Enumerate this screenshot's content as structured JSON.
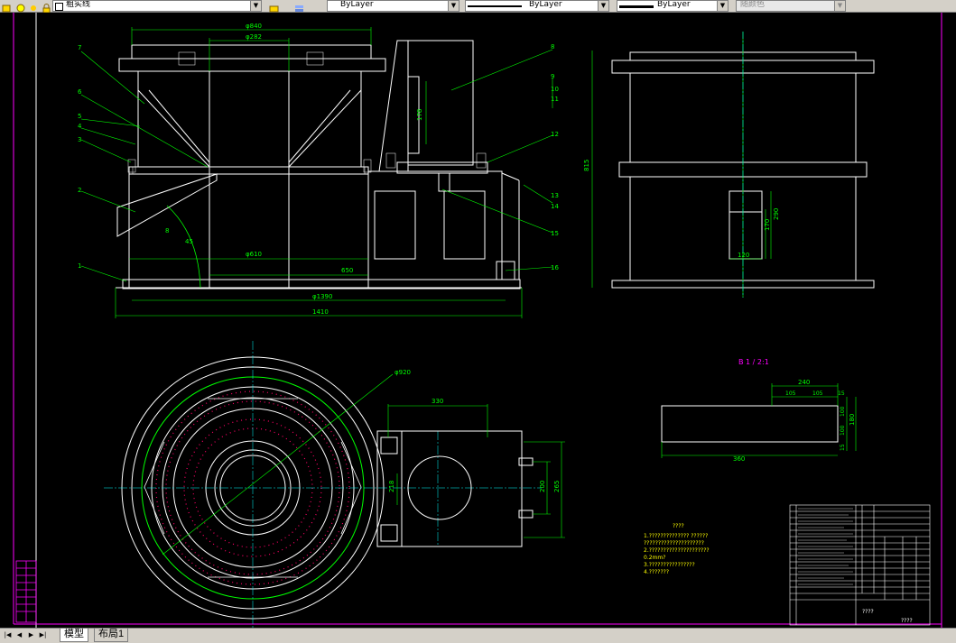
{
  "toolbar": {
    "layer_name": "粗实线",
    "color_value": "ByLayer",
    "linetype_value": "ByLayer",
    "lineweight_value": "ByLayer",
    "plotstyle_value": "随颜色"
  },
  "tabs": {
    "model": "模型",
    "layout1": "布局1"
  },
  "drawing": {
    "dims": {
      "d840": "φ840",
      "d282": "φ282",
      "d610": "φ610",
      "d1390": "φ1390",
      "w1410": "1410",
      "w650": "650",
      "h178": "178",
      "h815": "815",
      "d920": "φ920",
      "w330": "330",
      "h200": "200",
      "h265": "265",
      "h218": "218",
      "side170": "170",
      "side290": "290",
      "side120": "120",
      "a240": "240",
      "a105a": "105",
      "a105b": "105",
      "a15a": "15",
      "a100a": "100",
      "a100b": "100",
      "a15b": "15",
      "a180": "180",
      "a360": "360",
      "angle": "45",
      "angle2": "8"
    },
    "leaders": [
      "7",
      "6",
      "5",
      "4",
      "3",
      "2",
      "1",
      "8",
      "9",
      "10",
      "11",
      "12",
      "13",
      "14",
      "15",
      "16"
    ],
    "detail_label": "B 1 / 2:1",
    "notes_title": "????",
    "notes": [
      "1.??????????????  ??????",
      "  ?????????????????????",
      "2.?????????????????????",
      "  0.2mm?",
      "3.????????????????",
      "4.???????"
    ],
    "title_block_name": "????",
    "title_block_code": "????"
  },
  "colors": {
    "outline": "#ffffff",
    "dimension": "#00ff00",
    "leader": "#00ff00",
    "center": "#00ffff",
    "dot": "#ff0066",
    "magenta": "#ff00ff",
    "yellow": "#ffff00"
  }
}
